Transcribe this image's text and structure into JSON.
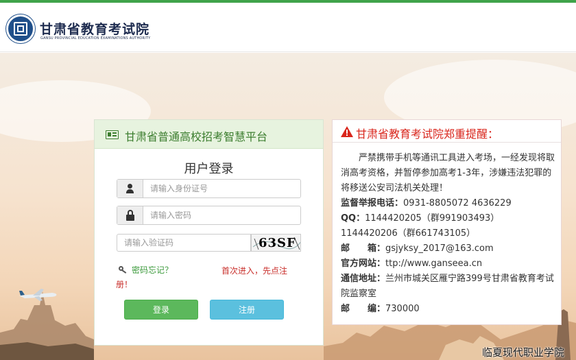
{
  "header": {
    "site_name": "甘肃省教育考试院",
    "site_name_en": "GANSU PROVINCIAL EDUCATION EXAMINATIONS AUTHORITY"
  },
  "login": {
    "platform_title": "甘肃省普通高校招考智慧平台",
    "form_title": "用户登录",
    "id_placeholder": "请输入身份证号",
    "password_placeholder": "请输入密码",
    "captcha_placeholder": "请输入验证码",
    "captcha_text": "63SF",
    "forgot_label": "密码忘记？",
    "first_time_tip": "首次进入，先点注册！",
    "login_button": "登录",
    "register_button": "注册"
  },
  "notice": {
    "title": "甘肃省教育考试院郑重提醒：",
    "paragraph": "严禁携带手机等通讯工具进入考场，一经发现将取消高考资格，并暂停参加高考1-3年，涉嫌违法犯罪的将移送公安司法机关处理！",
    "phone_label": "监督举报电话：",
    "phone_value": "0931-8805072 4636229",
    "qq_label": "QQ：",
    "qq_value_1": "1144420205（群991903493）",
    "qq_value_2": "1144420206（群661743105）",
    "email_label": "邮　　箱：",
    "email_value": "gsjyksy_2017@163.com",
    "website_label": "官方网站：",
    "website_value": "ttp://www.ganseea.cn",
    "address_label": "通信地址：",
    "address_value": "兰州市城关区雁宁路399号甘肃省教育考试院监察室",
    "postcode_label": "邮　　编：",
    "postcode_value": "730000"
  },
  "watermark": "临夏现代职业学院",
  "colors": {
    "accent_green": "#3fa34a",
    "login_button": "#5cb85c",
    "register_button": "#5bc0de",
    "warning_red": "#d9261c"
  }
}
